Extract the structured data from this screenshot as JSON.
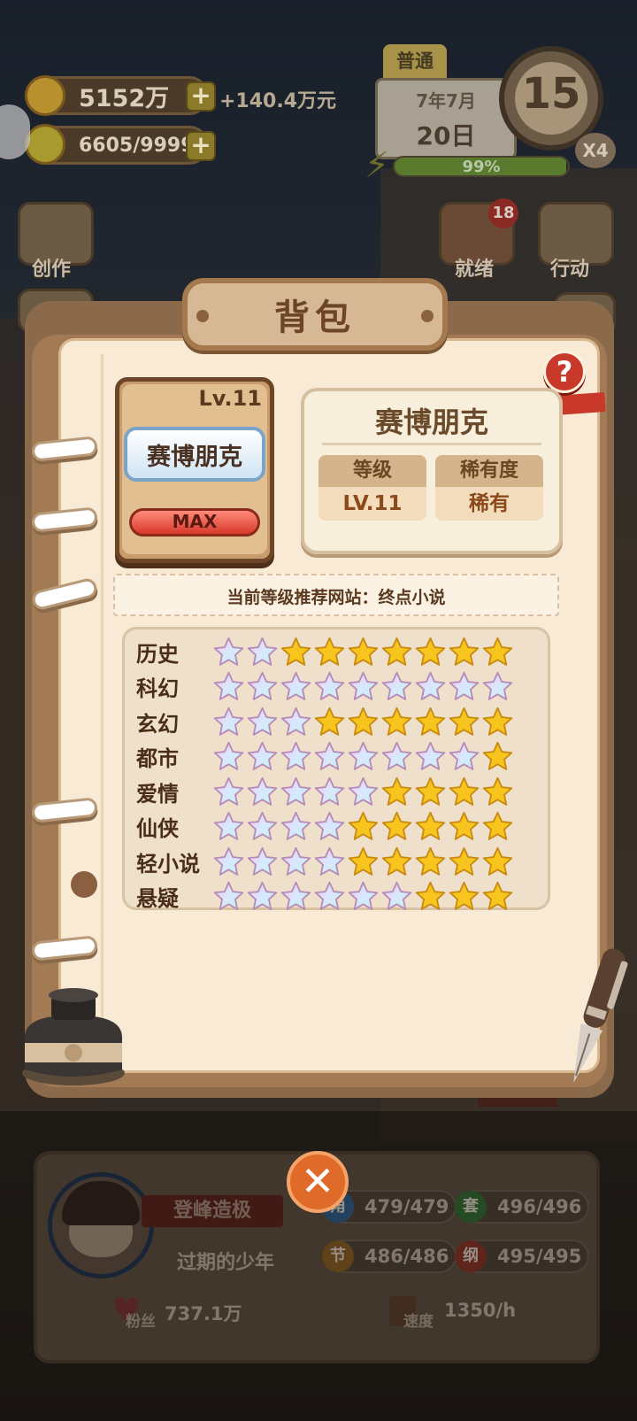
{
  "hud": {
    "gold": "5152万",
    "gold_income": "+140.4万元",
    "inspiration": "6605/9999"
  },
  "calendar": {
    "mode_tab": "普通",
    "month": "7年7月",
    "day": "20日",
    "stamina_value": "15",
    "multiplier": "X4",
    "energy_percent_label": "99%",
    "energy_fraction": 0.99
  },
  "side_buttons": {
    "create": "创作",
    "ready": "就绪",
    "ready_badge": "18",
    "action": "行动"
  },
  "panel": {
    "title": "背包",
    "help_label": "?"
  },
  "item": {
    "level": "Lv.11",
    "name": "赛博朋克",
    "max_label": "MAX"
  },
  "info": {
    "title": "赛博朋克",
    "level_header": "等级",
    "level_value": "LV.11",
    "rarity_header": "稀有度",
    "rarity_value": "稀有"
  },
  "recommendation": "当前等级推荐网站：终点小说",
  "genres": [
    {
      "name": "历史",
      "rainbow": 2,
      "gold": 7
    },
    {
      "name": "科幻",
      "rainbow": 9,
      "gold": 0
    },
    {
      "name": "玄幻",
      "rainbow": 3,
      "gold": 6
    },
    {
      "name": "都市",
      "rainbow": 8,
      "gold": 1
    },
    {
      "name": "爱情",
      "rainbow": 5,
      "gold": 4
    },
    {
      "name": "仙侠",
      "rainbow": 4,
      "gold": 5
    },
    {
      "name": "轻小说",
      "rainbow": 4,
      "gold": 5
    },
    {
      "name": "悬疑",
      "rainbow": 6,
      "gold": 3
    }
  ],
  "player": {
    "title": "登峰造极",
    "name": "过期的少年",
    "close_label": "✕",
    "attrs": [
      {
        "icon": "角",
        "value": "479/479",
        "color": "#3a6a9a"
      },
      {
        "icon": "套",
        "value": "496/496",
        "color": "#3a7a3a"
      },
      {
        "icon": "节",
        "value": "486/486",
        "color": "#9a6a2a"
      },
      {
        "icon": "纲",
        "value": "495/495",
        "color": "#9a3a2a"
      }
    ],
    "fans_label": "粉丝",
    "fans_value": "737.1万",
    "speed_label": "速度",
    "speed_value": "1350/h"
  },
  "colors": {
    "rainbow_star": "#e8c4f4",
    "gold_star": "#f7c51e"
  }
}
